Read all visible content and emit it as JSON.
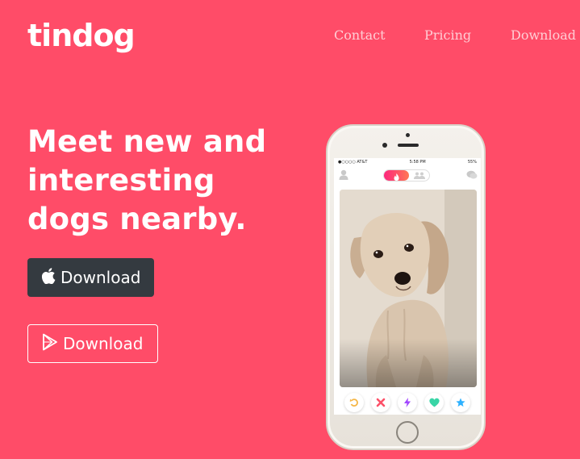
{
  "header": {
    "brand": "tindog",
    "nav": [
      "Contact",
      "Pricing",
      "Download"
    ]
  },
  "hero": {
    "headline_lines": [
      "Meet new and",
      "interesting",
      "dogs nearby."
    ],
    "apple_button_label": "Download",
    "play_button_label": "Download",
    "apple_icon": "apple-icon",
    "play_icon": "play-store-icon"
  },
  "phone": {
    "status": {
      "carrier": "●○○○○ AT&T",
      "time": "5:58 PM",
      "battery": "55%"
    },
    "photo_subject": "dog-photo",
    "actions": [
      "rewind-icon",
      "nope-icon",
      "boost-icon",
      "like-icon",
      "superlike-icon"
    ]
  },
  "colors": {
    "background": "#ff4c68",
    "dark_button": "#343a40",
    "tinder_gradient_start": "#fd267d",
    "tinder_gradient_end": "#ff7854"
  }
}
